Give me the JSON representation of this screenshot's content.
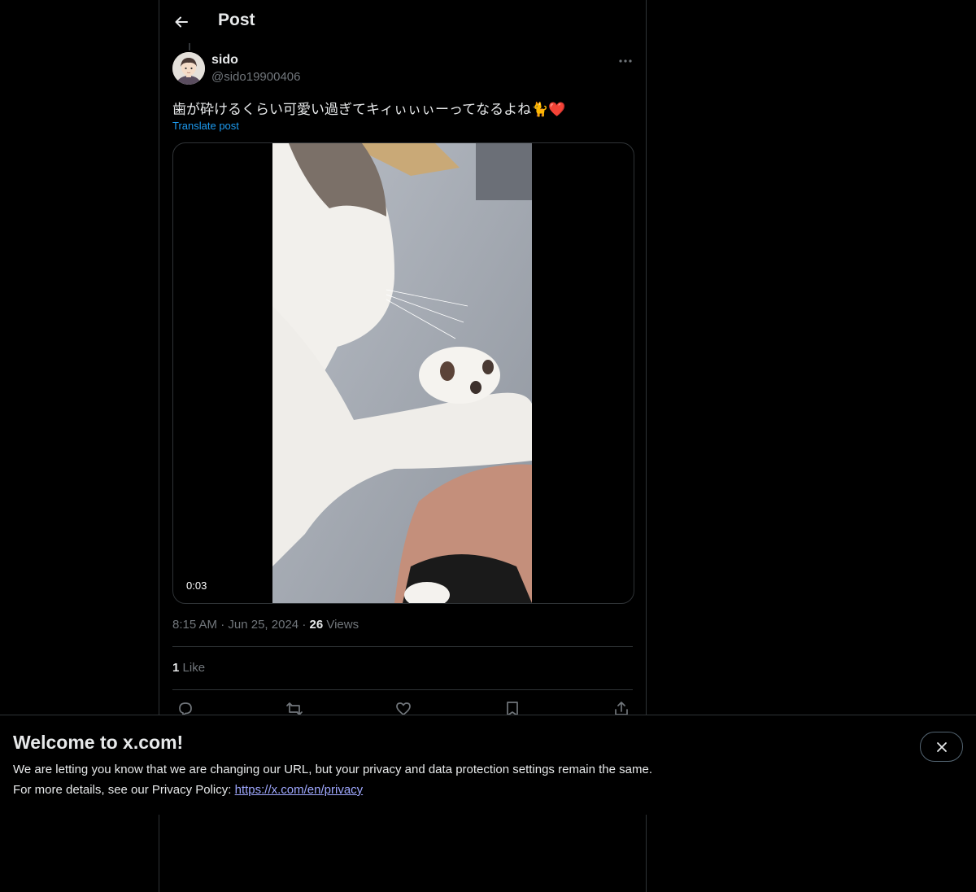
{
  "header": {
    "title": "Post",
    "back_icon": "arrow-left-icon"
  },
  "post": {
    "author_name": "sido",
    "author_handle": "@sido19900406",
    "text": "歯が砕けるくらい可愛い過ぎてキィぃぃぃーってなるよね🐈❤️",
    "translate_label": "Translate post",
    "video_duration": "0:03",
    "time": "8:15 AM",
    "separator": "·",
    "date": "Jun 25, 2024",
    "views_count": "26",
    "views_label": "Views",
    "likes_count": "1",
    "likes_label": "Like"
  },
  "actions": [
    "reply-icon",
    "repost-icon",
    "like-icon",
    "bookmark-icon",
    "share-icon"
  ],
  "banner": {
    "title": "Welcome to x.com!",
    "line1": "We are letting you know that we are changing our URL, but your privacy and data protection settings remain the same.",
    "line2_prefix": "For more details, see our Privacy Policy:",
    "link": "https://x.com/en/privacy",
    "close_icon": "close-icon"
  },
  "colors": {
    "background": "#000000",
    "text": "#e7e9ea",
    "muted": "#71767b",
    "accent": "#1d9bf0",
    "link": "#9fa8ff"
  }
}
